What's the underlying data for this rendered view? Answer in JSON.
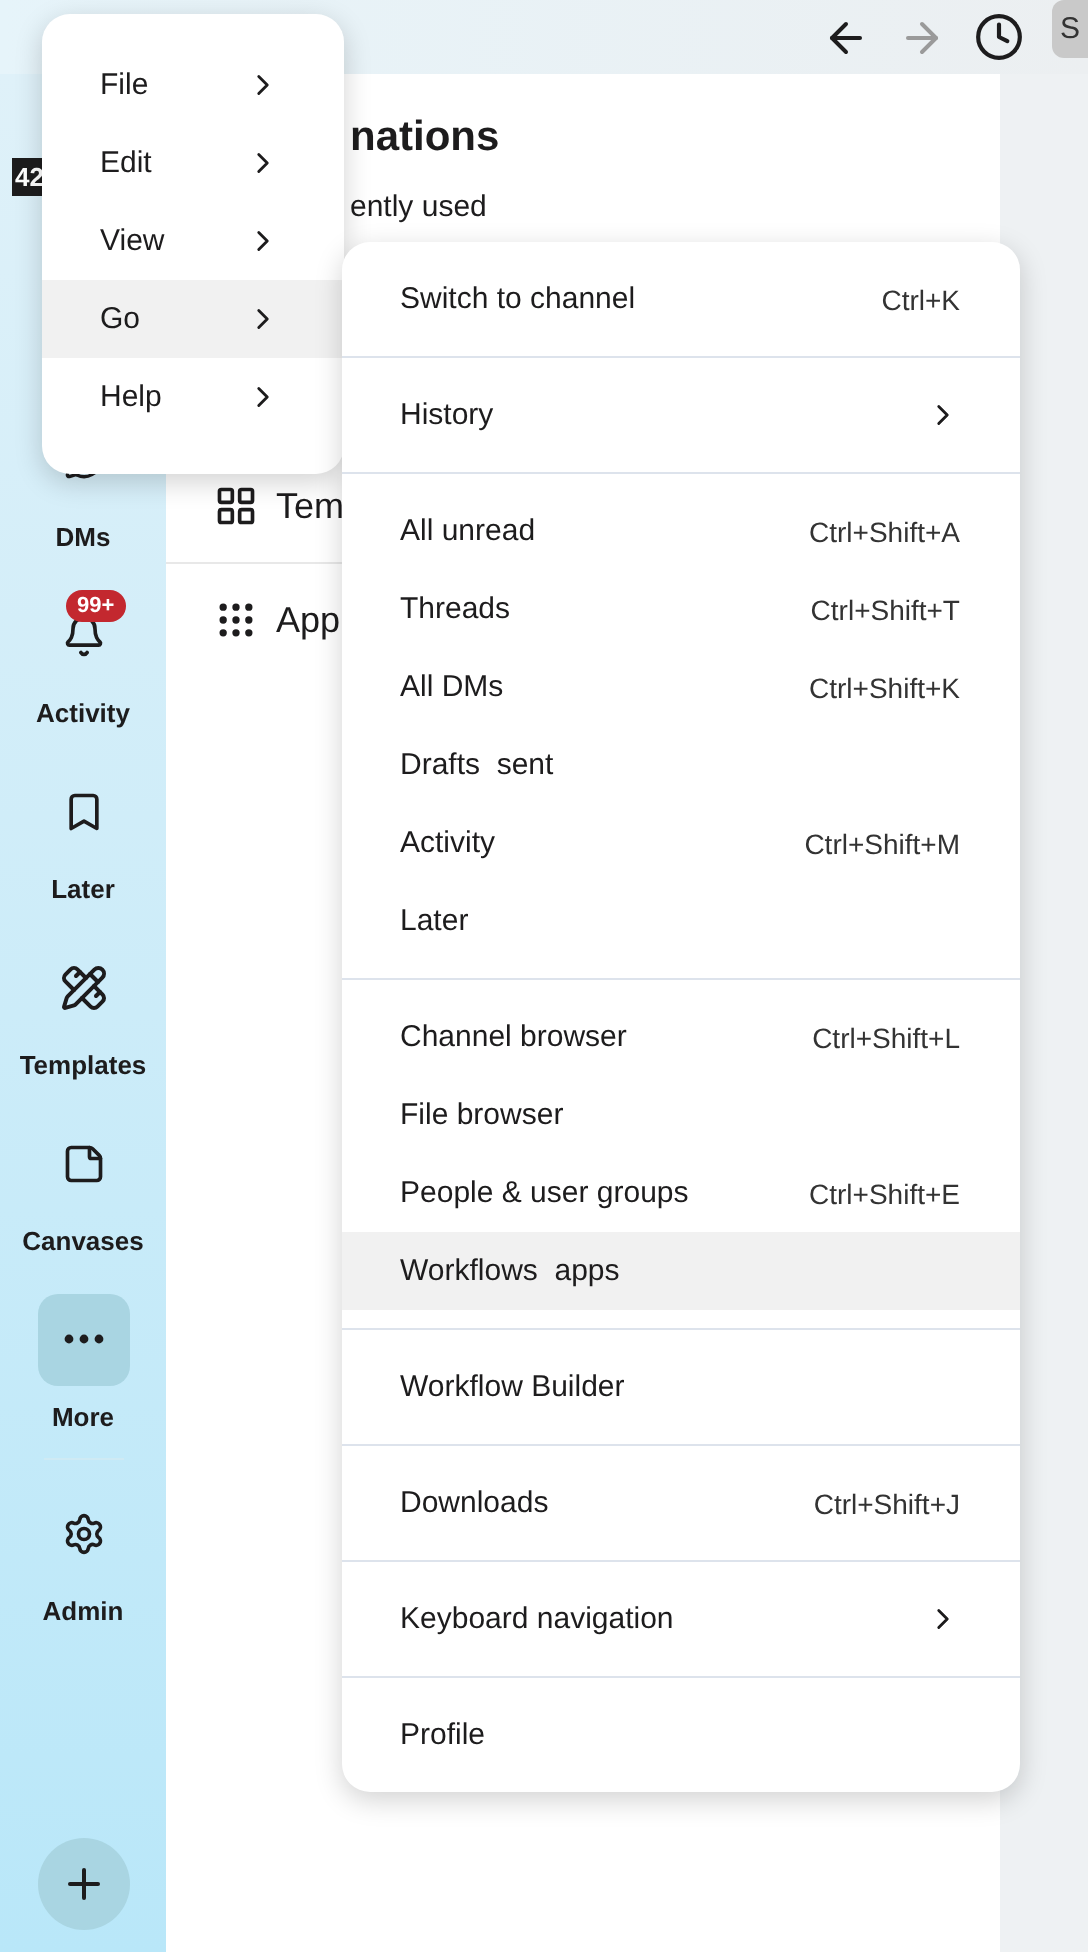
{
  "top_bar": {
    "back_disabled": false,
    "forward_disabled": true,
    "search": {
      "value": "S"
    }
  },
  "workspace": {
    "badge": "42"
  },
  "sidebar": {
    "items": [
      {
        "kind": "dms",
        "label": "DMs",
        "selected": false
      },
      {
        "kind": "activity",
        "label": "Activity",
        "badge": "99+",
        "selected": false
      },
      {
        "kind": "later",
        "label": "Later",
        "selected": false
      },
      {
        "kind": "templates",
        "label": "Templates",
        "selected": false
      },
      {
        "kind": "canvases",
        "label": "Canvases",
        "selected": false
      },
      {
        "kind": "more",
        "label": "More",
        "selected": true
      },
      {
        "kind": "divider"
      },
      {
        "kind": "admin",
        "label": "Admin",
        "selected": false
      }
    ]
  },
  "panel": {
    "title": "nations",
    "subtitle": "ently used",
    "rows": [
      {
        "kind": "templates",
        "label": "Tem"
      },
      {
        "kind": "apps",
        "label": "App"
      }
    ]
  },
  "menu": {
    "items": [
      {
        "label": "File",
        "selected": false
      },
      {
        "label": "Edit",
        "selected": false
      },
      {
        "label": "View",
        "selected": false
      },
      {
        "label": "Go",
        "selected": true
      },
      {
        "label": "Help",
        "selected": false
      }
    ]
  },
  "submenu": {
    "groups": [
      [
        {
          "label": "Switch to channel",
          "shortcut": "Ctrl+K",
          "selected": false
        }
      ],
      [
        {
          "label": "History",
          "submenu": true,
          "selected": false
        }
      ],
      [
        {
          "label": "All unread",
          "shortcut": "Ctrl+Shift+A",
          "selected": false
        },
        {
          "label": "Threads",
          "shortcut": "Ctrl+Shift+T",
          "selected": false
        },
        {
          "label": "All DMs",
          "shortcut": "Ctrl+Shift+K",
          "selected": false
        },
        {
          "label": "Drafts  sent",
          "selected": false
        },
        {
          "label": "Activity",
          "shortcut": "Ctrl+Shift+M",
          "selected": false
        },
        {
          "label": "Later",
          "selected": false
        }
      ],
      [
        {
          "label": "Channel browser",
          "shortcut": "Ctrl+Shift+L",
          "selected": false
        },
        {
          "label": "File browser",
          "selected": false
        },
        {
          "label": "People & user groups",
          "shortcut": "Ctrl+Shift+E",
          "selected": false
        },
        {
          "label": "Workflows  apps",
          "selected": true
        }
      ],
      [
        {
          "label": "Workflow Builder",
          "selected": false
        }
      ],
      [
        {
          "label": "Downloads",
          "shortcut": "Ctrl+Shift+J",
          "selected": false
        }
      ],
      [
        {
          "label": "Keyboard navigation",
          "submenu": true,
          "selected": false
        }
      ],
      [
        {
          "label": "Profile",
          "selected": false
        }
      ]
    ]
  }
}
